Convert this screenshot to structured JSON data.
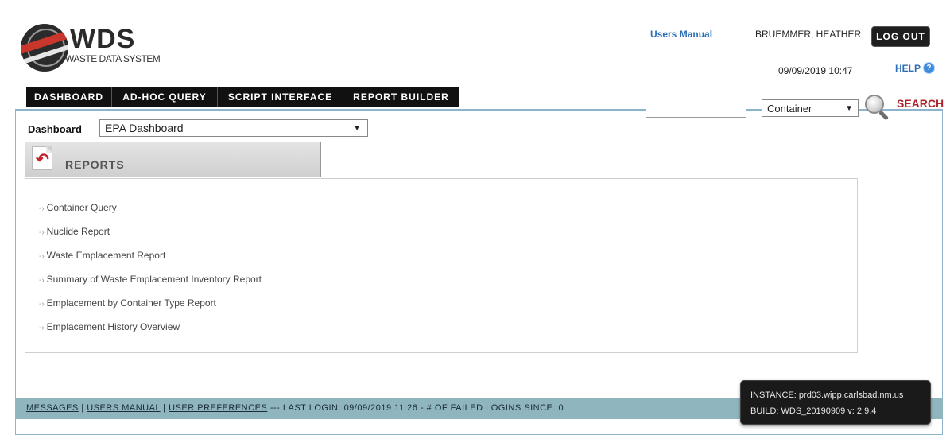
{
  "app": {
    "logo_title": "WDS",
    "logo_subtitle": "WASTE DATA SYSTEM"
  },
  "header": {
    "users_manual": "Users Manual",
    "user_name": "BRUEMMER, HEATHER",
    "logout_label": "LOG OUT",
    "datetime": "09/09/2019 10:47",
    "help_label": "HELP"
  },
  "nav": {
    "tabs": [
      {
        "label": "DASHBOARD"
      },
      {
        "label": "AD-HOC QUERY"
      },
      {
        "label": "SCRIPT INTERFACE"
      },
      {
        "label": "REPORT BUILDER"
      }
    ]
  },
  "search": {
    "input_value": "",
    "type_selected": "Container",
    "label": "SEARCH"
  },
  "dashboard": {
    "label": "Dashboard",
    "selected": "EPA Dashboard"
  },
  "reports": {
    "header": "REPORTS",
    "items": [
      {
        "label": "Container Query"
      },
      {
        "label": "Nuclide Report"
      },
      {
        "label": "Waste Emplacement Report"
      },
      {
        "label": "Summary of Waste Emplacement Inventory Report"
      },
      {
        "label": "Emplacement by Container Type Report"
      },
      {
        "label": "Emplacement History Overview"
      }
    ]
  },
  "footer": {
    "messages": "MESSAGES",
    "users_manual": "USERS MANUAL",
    "user_preferences": "USER PREFERENCES",
    "last_login_text": "--- LAST LOGIN: 09/09/2019 11:26 - # OF FAILED LOGINS SINCE: 0",
    "instance": "INSTANCE: prd03.wipp.carlsbad.nm.us",
    "build": "BUILD: WDS_20190909 v: 2.9.4"
  },
  "colors": {
    "accent_blue": "#2c6fb5",
    "search_red": "#b0242b",
    "footer_bar": "#8fb6bf",
    "panel_border": "#8db4cc"
  }
}
